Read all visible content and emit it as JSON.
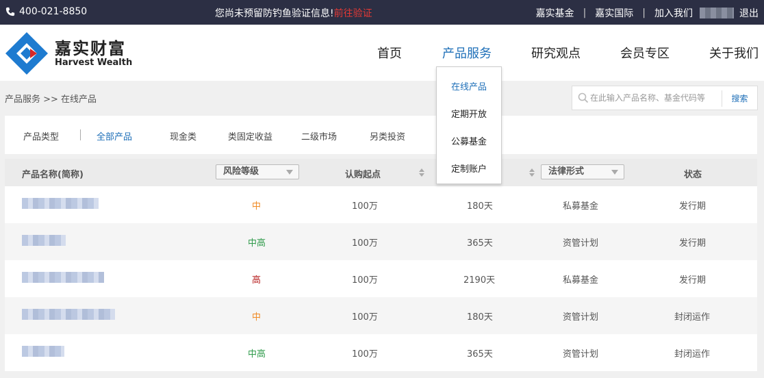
{
  "topbar": {
    "phone": "400-021-8850",
    "notice": "您尚未预留防钓鱼验证信息!",
    "verify_link": "前往验证",
    "links": [
      "嘉实基金",
      "嘉实国际",
      "加入我们"
    ],
    "separator": "|",
    "logout": "退出"
  },
  "logo": {
    "cn": "嘉实财富",
    "en": "Harvest Wealth"
  },
  "nav": [
    {
      "label": "首页",
      "active": false
    },
    {
      "label": "产品服务",
      "active": true
    },
    {
      "label": "研究观点",
      "active": false
    },
    {
      "label": "会员专区",
      "active": false
    },
    {
      "label": "关于我们",
      "active": false
    }
  ],
  "dropdown": [
    "在线产品",
    "定期开放",
    "公募基金",
    "定制账户"
  ],
  "breadcrumb": "产品服务 >> 在线产品",
  "search": {
    "placeholder": "在此输入产品名称、基金代码等",
    "button": "搜索"
  },
  "filters": {
    "label": "产品类型",
    "items": [
      "全部产品",
      "现金类",
      "类固定收益",
      "二级市场",
      "另类投资"
    ]
  },
  "table": {
    "headers": {
      "name": "产品名称(简称)",
      "risk": "风险等级",
      "min": "认购起点",
      "legal": "法律形式",
      "status": "状态"
    },
    "rows": [
      {
        "risk": "中",
        "min": "100万",
        "term": "180天",
        "legal": "私募基金",
        "status": "发行期"
      },
      {
        "risk": "中高",
        "min": "100万",
        "term": "365天",
        "legal": "资管计划",
        "status": "发行期"
      },
      {
        "risk": "高",
        "min": "100万",
        "term": "2190天",
        "legal": "私募基金",
        "status": "发行期"
      },
      {
        "risk": "中",
        "min": "100万",
        "term": "180天",
        "legal": "资管计划",
        "status": "封闭运作"
      },
      {
        "risk": "中高",
        "min": "100万",
        "term": "365天",
        "legal": "资管计划",
        "status": "封闭运作"
      }
    ]
  },
  "colors": {
    "topbar": "#2c2f44",
    "accent": "#1e6fb8",
    "alert": "#e53935",
    "risk_mid": "#f08a24",
    "risk_midhigh": "#2e9a4a",
    "risk_high": "#b71c1c"
  }
}
